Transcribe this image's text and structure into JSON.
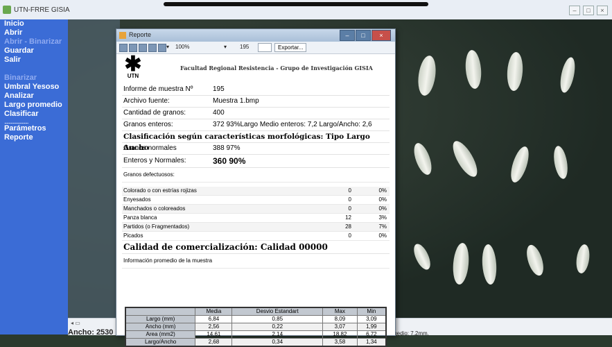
{
  "window": {
    "title": "UTN-FRRE GISIA"
  },
  "sidebar": {
    "items": [
      {
        "label": "Inicio",
        "enabled": true
      },
      {
        "label": "Abrir",
        "enabled": true
      },
      {
        "label": "Abrir - Binarizar",
        "enabled": false
      },
      {
        "label": "Guardar",
        "enabled": true
      },
      {
        "label": "Salir",
        "enabled": true
      },
      {
        "label": "",
        "enabled": true
      },
      {
        "label": "Binarizar",
        "enabled": false
      },
      {
        "label": "Umbral Yesoso",
        "enabled": true
      },
      {
        "label": "Analizar",
        "enabled": true
      },
      {
        "label": "Largo promedio",
        "enabled": true
      },
      {
        "label": "Clasificar",
        "enabled": true
      },
      {
        "label": "",
        "enabled": true
      },
      {
        "label": "Parámetros",
        "enabled": true
      },
      {
        "label": "Reporte",
        "enabled": true
      }
    ],
    "separator": "......................."
  },
  "status": {
    "left": "Ancho: 2530",
    "right": "medio: 7.2mm."
  },
  "report": {
    "title": "Reporte",
    "toolbar": {
      "zoom": "100%",
      "page": "195",
      "export_label": "Exportar..."
    },
    "header": "Facultad Regional Resistencia - Grupo de Investigación GISIA",
    "logo_text": "UTN",
    "rows": {
      "informe_label": "Informe de muestra Nº",
      "informe_value": "195",
      "archivo_label": "Archivo fuente:",
      "archivo_value": "Muestra 1.bmp",
      "cantidad_label": "Cantidad de granos:",
      "cantidad_value": "400",
      "enteros_label": "Granos enteros:",
      "enteros_value": "372 93%Largo Medio enteros: 7,2 Largo/Ancho: 2,6",
      "clasif": "Clasificación según características morfológicas: Tipo Largo Ancho",
      "normales_label": "Granos normales",
      "normales_value": "388 97%",
      "enteros_normales_label": "Enteros y Normales:",
      "enteros_normales_value": "360  90%"
    },
    "defectuosos_title": "Granos defectuosos:",
    "defects": [
      {
        "label": "Colorado o con estrías rojizas",
        "n": "0",
        "p": "0%"
      },
      {
        "label": "Enyesados",
        "n": "0",
        "p": "0%"
      },
      {
        "label": "Manchados o coloreados",
        "n": "0",
        "p": "0%"
      },
      {
        "label": "Panza blanca",
        "n": "12",
        "p": "3%"
      },
      {
        "label": "Partidos (o Fragmentados)",
        "n": "28",
        "p": "7%"
      },
      {
        "label": "Picados",
        "n": "0",
        "p": "0%"
      }
    ],
    "calidad": "Calidad de comercialización: Calidad 00000",
    "promedio_title": "Información promedio de la muestra",
    "stats": {
      "headers": [
        "",
        "Media",
        "Desvio Estandart",
        "Max",
        "Min"
      ],
      "rows": [
        [
          "Largo (mm)",
          "6,84",
          "0,85",
          "8,09",
          "3,09"
        ],
        [
          "Ancho (mm)",
          "2,56",
          "0,22",
          "3,07",
          "1,99"
        ],
        [
          "Area (mm2)",
          "14,61",
          "2,14",
          "18,82",
          "6,72"
        ],
        [
          "Largo/Ancho",
          "2,68",
          "0,34",
          "3,58",
          "1,34"
        ]
      ]
    }
  }
}
